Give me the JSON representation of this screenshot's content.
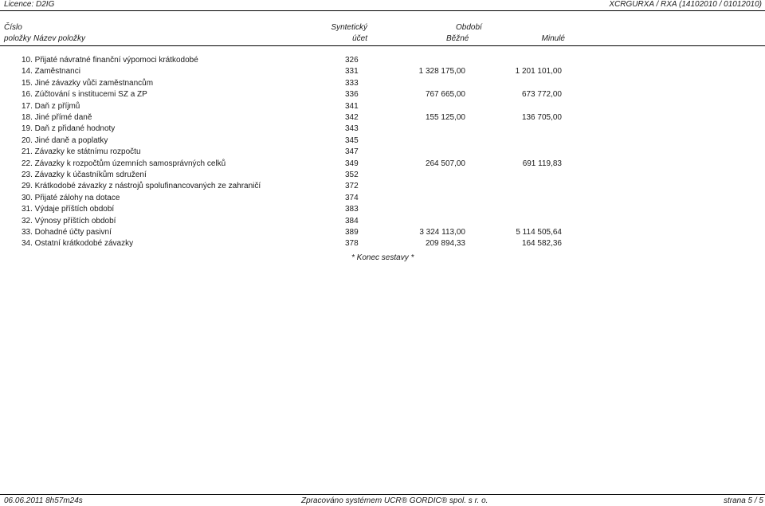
{
  "header": {
    "licence": "Licence: D2IG",
    "report_code": "XCRGURXA / RXA (14102010 / 01012010)"
  },
  "columns": {
    "number_top": "Číslo",
    "number_bottom": "položky",
    "name": "Název položky",
    "synthetic_top": "Syntetický",
    "synthetic_bottom": "účet",
    "period": "Období",
    "current": "Běžné",
    "previous": "Minulé"
  },
  "rows": [
    {
      "name": "10.  Přijaté návratné finanční výpomoci krátkodobé",
      "account": "326",
      "current": "",
      "previous": ""
    },
    {
      "name": "14.  Zaměstnanci",
      "account": "331",
      "current": "1 328 175,00",
      "previous": "1 201 101,00"
    },
    {
      "name": "15.  Jiné závazky vůči zaměstnancům",
      "account": "333",
      "current": "",
      "previous": ""
    },
    {
      "name": "16.  Zúčtování s institucemi SZ a ZP",
      "account": "336",
      "current": "767 665,00",
      "previous": "673 772,00"
    },
    {
      "name": "17.  Daň z příjmů",
      "account": "341",
      "current": "",
      "previous": ""
    },
    {
      "name": "18.  Jiné přímé daně",
      "account": "342",
      "current": "155 125,00",
      "previous": "136 705,00"
    },
    {
      "name": "19.  Daň z přidané hodnoty",
      "account": "343",
      "current": "",
      "previous": ""
    },
    {
      "name": "20.  Jiné daně a poplatky",
      "account": "345",
      "current": "",
      "previous": ""
    },
    {
      "name": "21.  Závazky ke státnímu rozpočtu",
      "account": "347",
      "current": "",
      "previous": ""
    },
    {
      "name": "22.  Závazky k rozpočtům územních samosprávných celků",
      "account": "349",
      "current": "264 507,00",
      "previous": "691 119,83"
    },
    {
      "name": "23.  Závazky k účastníkům sdružení",
      "account": "352",
      "current": "",
      "previous": ""
    },
    {
      "name": "29.  Krátkodobé závazky z nástrojů spolufinancovaných ze zahraničí",
      "account": "372",
      "current": "",
      "previous": ""
    },
    {
      "name": "30.  Přijaté zálohy na dotace",
      "account": "374",
      "current": "",
      "previous": ""
    },
    {
      "name": "31.  Výdaje příštích období",
      "account": "383",
      "current": "",
      "previous": ""
    },
    {
      "name": "32.  Výnosy příštích období",
      "account": "384",
      "current": "",
      "previous": ""
    },
    {
      "name": "33.  Dohadné účty pasivní",
      "account": "389",
      "current": "3 324 113,00",
      "previous": "5 114 505,64"
    },
    {
      "name": "34.  Ostatní krátkodobé závazky",
      "account": "378",
      "current": "209 894,33",
      "previous": "164 582,36"
    }
  ],
  "end_note": "* Konec sestavy *",
  "footer": {
    "timestamp": "06.06.2011 8h57m24s",
    "processed_by": "Zpracováno systémem  UCR® GORDIC® spol. s  r. o.",
    "page": "strana 5 / 5"
  }
}
